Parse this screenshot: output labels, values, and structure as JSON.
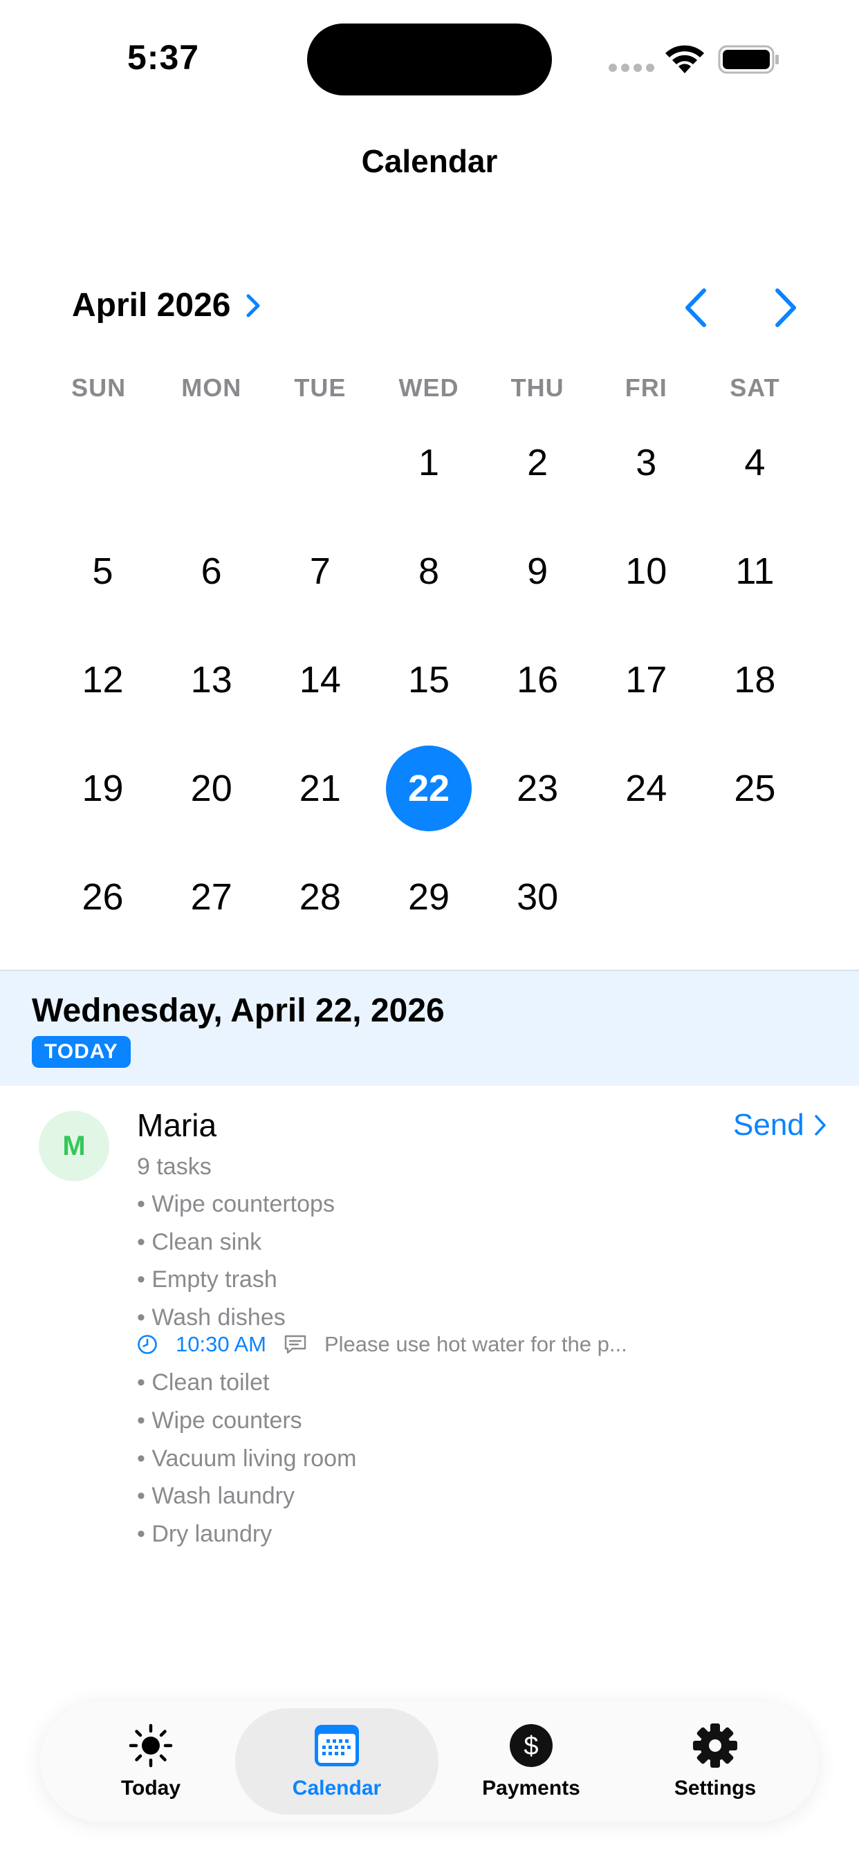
{
  "status_bar": {
    "time": "5:37"
  },
  "nav": {
    "title": "Calendar"
  },
  "calendar": {
    "month_label": "April 2026",
    "weekdays": [
      "SUN",
      "MON",
      "TUE",
      "WED",
      "THU",
      "FRI",
      "SAT"
    ],
    "days": [
      "",
      "",
      "",
      "1",
      "2",
      "3",
      "4",
      "5",
      "6",
      "7",
      "8",
      "9",
      "10",
      "11",
      "12",
      "13",
      "14",
      "15",
      "16",
      "17",
      "18",
      "19",
      "20",
      "21",
      "22",
      "23",
      "24",
      "25",
      "26",
      "27",
      "28",
      "29",
      "30",
      "",
      ""
    ],
    "selected_day": "22",
    "accent_color": "#0a84ff"
  },
  "selected_date": {
    "title": "Wednesday, April 22, 2026",
    "badge": "TODAY"
  },
  "person": {
    "initial": "M",
    "name": "Maria",
    "send_label": "Send",
    "task_count": "9 tasks",
    "tasks": [
      "Wipe countertops",
      "Clean sink",
      "Empty trash",
      "Wash dishes",
      "Clean toilet",
      "Wipe counters",
      "Vacuum living room",
      "Wash laundry",
      "Dry laundry"
    ],
    "task_meta": {
      "time": "10:30 AM",
      "note": "Please use hot water for the p..."
    }
  },
  "tab_bar": {
    "tabs": [
      {
        "label": "Today",
        "icon": "sun-icon"
      },
      {
        "label": "Calendar",
        "icon": "calendar-icon"
      },
      {
        "label": "Payments",
        "icon": "dollar-icon"
      },
      {
        "label": "Settings",
        "icon": "gear-icon"
      }
    ],
    "active": "Calendar"
  }
}
